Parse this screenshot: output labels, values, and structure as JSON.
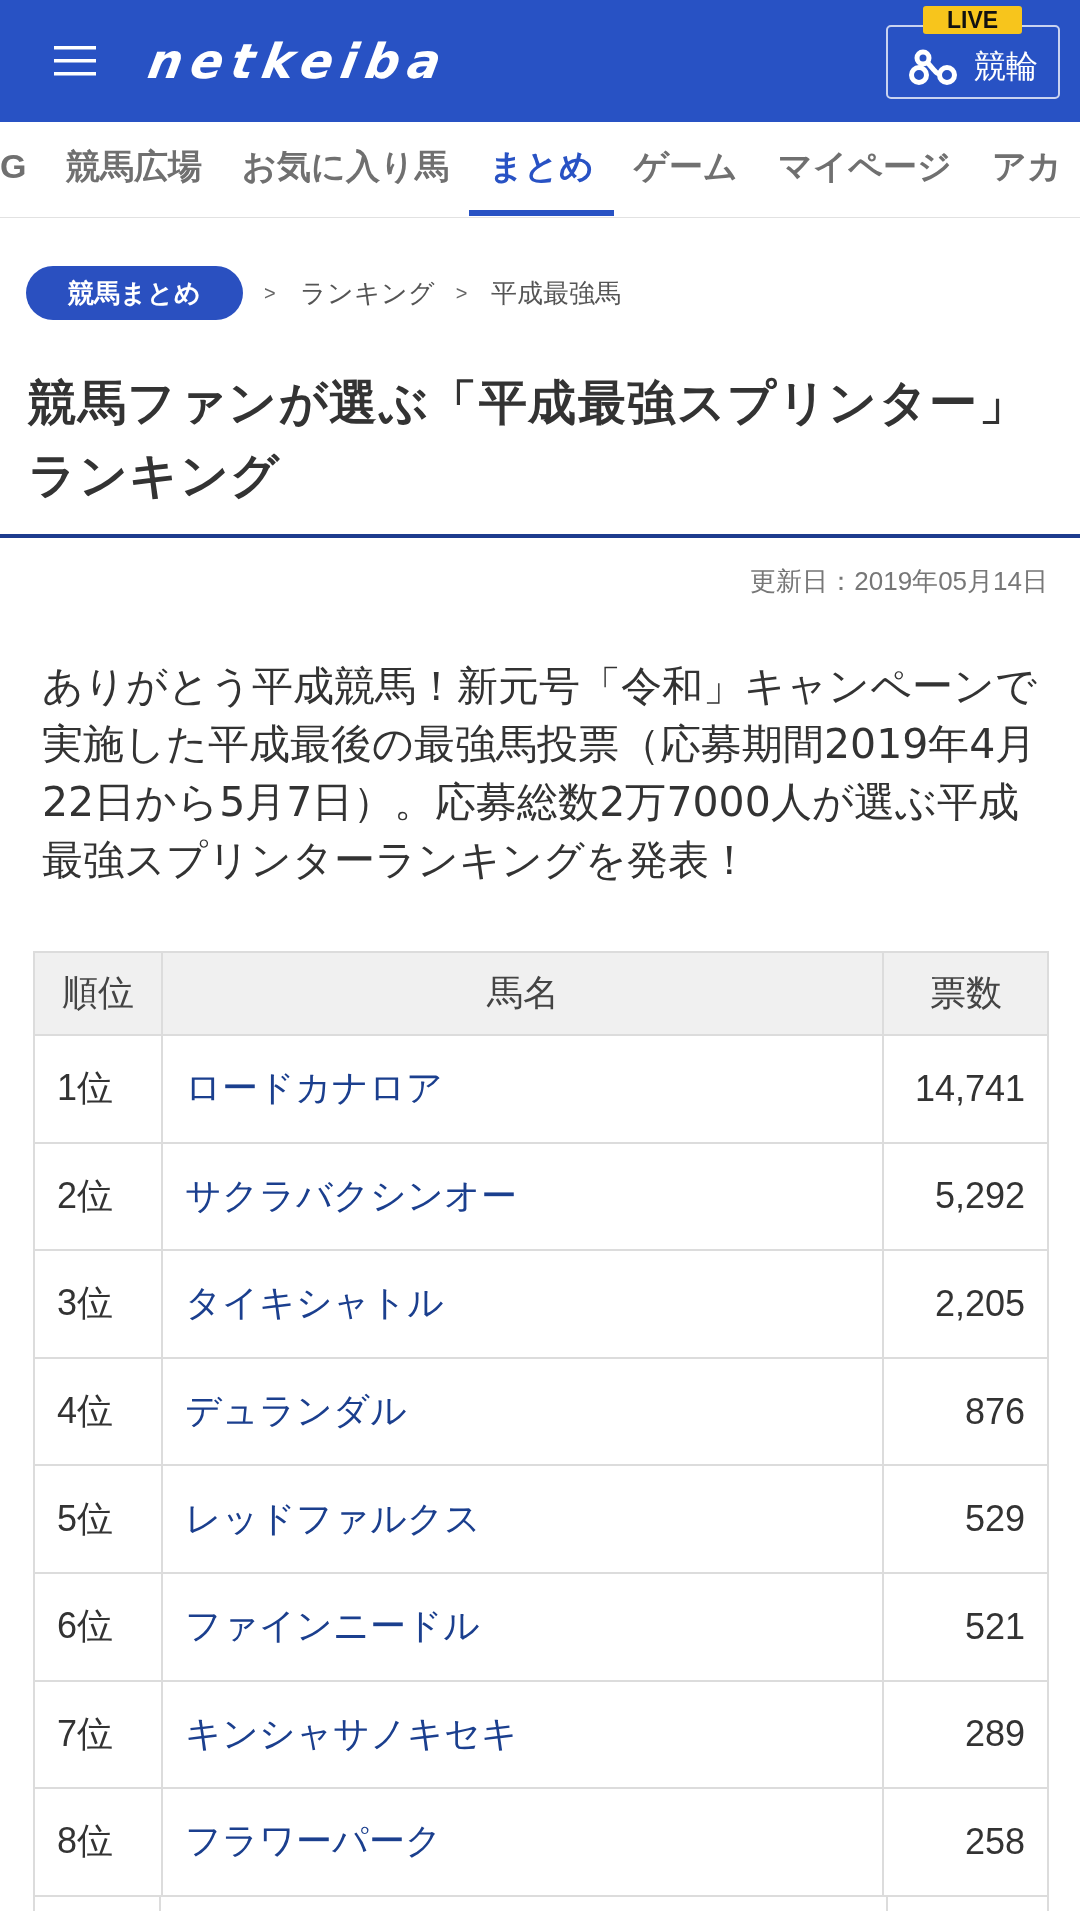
{
  "header": {
    "logo": "netkeiba",
    "live": {
      "badge": "LIVE",
      "label": "競輪"
    }
  },
  "nav": {
    "items": [
      {
        "label": "G",
        "selected": false
      },
      {
        "label": "競馬広場",
        "selected": false
      },
      {
        "label": "お気に入り馬",
        "selected": false
      },
      {
        "label": "まとめ",
        "selected": true
      },
      {
        "label": "ゲーム",
        "selected": false
      },
      {
        "label": "マイページ",
        "selected": false
      },
      {
        "label": "アカ",
        "selected": false
      }
    ]
  },
  "breadcrumb": {
    "home": "競馬まとめ",
    "trail": [
      {
        "separator": ">",
        "label": "ランキング"
      },
      {
        "separator": ">",
        "label": "平成最強馬"
      }
    ]
  },
  "article": {
    "title": "競馬ファンが選ぶ「平成最強スプリンター」ランキング",
    "updated": "更新日：2019年05月14日",
    "lead": "ありがとう平成競馬！新元号「令和」キャンペーンで実施した平成最後の最強馬投票（応募期間2019年4月22日から5月7日）。応募総数2万7000人が選ぶ平成最強スプリンターランキングを発表！"
  },
  "table": {
    "columns": [
      "順位",
      "馬名",
      "票数"
    ],
    "rows": [
      {
        "rank": "1位",
        "name": "ロードカナロア",
        "votes": "14,741"
      },
      {
        "rank": "2位",
        "name": "サクラバクシンオー",
        "votes": "5,292"
      },
      {
        "rank": "3位",
        "name": "タイキシャトル",
        "votes": "2,205"
      },
      {
        "rank": "4位",
        "name": "デュランダル",
        "votes": "876"
      },
      {
        "rank": "5位",
        "name": "レッドファルクス",
        "votes": "529"
      },
      {
        "rank": "6位",
        "name": "ファインニードル",
        "votes": "521"
      },
      {
        "rank": "7位",
        "name": "キンシャサノキセキ",
        "votes": "289"
      },
      {
        "rank": "8位",
        "name": "フラワーパーク",
        "votes": "258"
      }
    ]
  }
}
